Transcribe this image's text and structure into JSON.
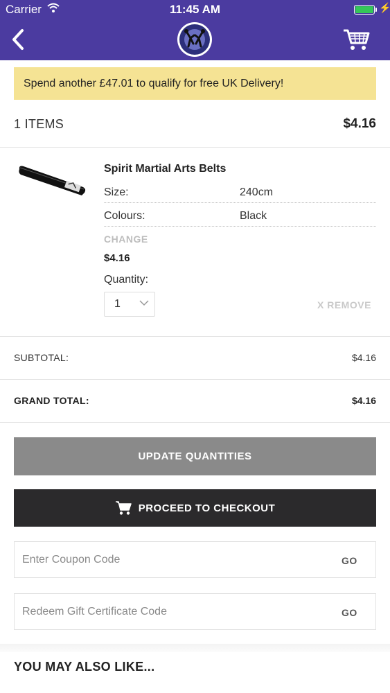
{
  "status_bar": {
    "carrier": "Carrier",
    "time": "11:45 AM",
    "battery_level": 1.0
  },
  "header": {
    "back_icon": "chevron-left-icon",
    "logo": "martial-arts-logo",
    "cart_icon": "shopping-cart-icon"
  },
  "promo": {
    "text": "Spend another £47.01 to qualify for free UK Delivery!"
  },
  "cart": {
    "items_label": "1 ITEMS",
    "total": "$4.16"
  },
  "product": {
    "name": "Spirit Martial Arts Belts",
    "attributes": [
      {
        "label": "Size:",
        "value": "240cm"
      },
      {
        "label": "Colours:",
        "value": "Black"
      }
    ],
    "change_label": "CHANGE",
    "price": "$4.16",
    "quantity_label": "Quantity:",
    "quantity_value": "1",
    "remove_label": "X REMOVE"
  },
  "summary": {
    "subtotal_label": "SUBTOTAL:",
    "subtotal_value": "$4.16",
    "grand_total_label": "GRAND TOTAL:",
    "grand_total_value": "$4.16"
  },
  "buttons": {
    "update": "UPDATE QUANTITIES",
    "checkout": "PROCEED TO CHECKOUT"
  },
  "coupon": {
    "placeholder": "Enter Coupon Code",
    "go": "GO"
  },
  "gift": {
    "placeholder": "Redeem Gift Certificate Code",
    "go": "GO"
  },
  "also_like": "YOU MAY ALSO LIKE...",
  "colors": {
    "header": "#4b3ba0",
    "promo": "#f5e394",
    "update_button": "#8a8a8a",
    "checkout_button": "#2b2a2c"
  }
}
